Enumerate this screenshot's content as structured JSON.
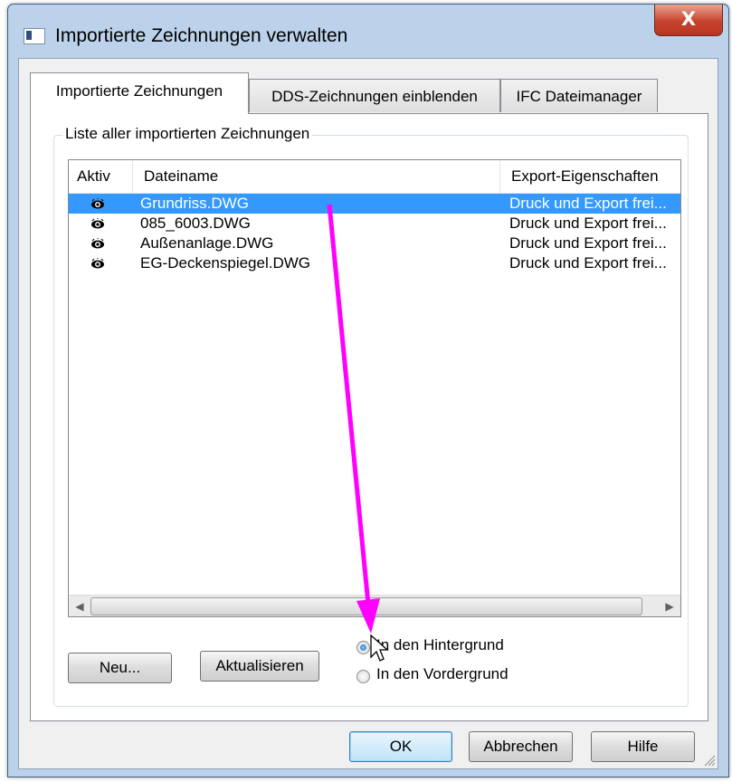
{
  "window": {
    "title": "Importierte Zeichnungen verwalten",
    "close_glyph": "X"
  },
  "tabs": [
    {
      "label": "Importierte Zeichnungen",
      "active": true
    },
    {
      "label": "DDS-Zeichnungen einblenden",
      "active": false
    },
    {
      "label": "IFC Dateimanager",
      "active": false
    }
  ],
  "group": {
    "legend": "Liste aller importierten Zeichnungen"
  },
  "list": {
    "columns": [
      "Aktiv",
      "Dateiname",
      "Export-Eigenschaften"
    ],
    "rows": [
      {
        "active_icon": "eye-icon",
        "file": "Grundriss.DWG",
        "export": "Druck und Export frei...",
        "selected": true
      },
      {
        "active_icon": "eye-icon",
        "file": "085_6003.DWG",
        "export": "Druck und Export frei...",
        "selected": false
      },
      {
        "active_icon": "eye-icon",
        "file": "Außenanlage.DWG",
        "export": "Druck und Export frei...",
        "selected": false
      },
      {
        "active_icon": "eye-icon",
        "file": "EG-Deckenspiegel.DWG",
        "export": "Druck und Export frei...",
        "selected": false
      }
    ]
  },
  "buttons": {
    "new": "Neu...",
    "refresh": "Aktualisieren",
    "ok": "OK",
    "cancel": "Abbrechen",
    "help": "Hilfe"
  },
  "radios": [
    {
      "label": "In den Hintergrund",
      "checked": true
    },
    {
      "label": "In den Vordergrund",
      "checked": false
    }
  ],
  "colors": {
    "selection": "#3399ff",
    "annotation_arrow": "#ff00ff"
  }
}
